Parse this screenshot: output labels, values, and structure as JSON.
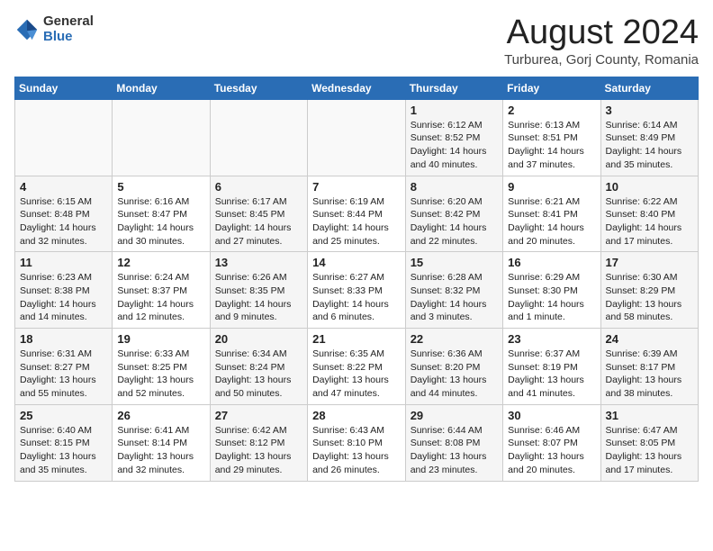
{
  "logo": {
    "general": "General",
    "blue": "Blue"
  },
  "title": "August 2024",
  "location": "Turburea, Gorj County, Romania",
  "headers": [
    "Sunday",
    "Monday",
    "Tuesday",
    "Wednesday",
    "Thursday",
    "Friday",
    "Saturday"
  ],
  "weeks": [
    [
      {
        "day": "",
        "info": ""
      },
      {
        "day": "",
        "info": ""
      },
      {
        "day": "",
        "info": ""
      },
      {
        "day": "",
        "info": ""
      },
      {
        "day": "1",
        "info": "Sunrise: 6:12 AM\nSunset: 8:52 PM\nDaylight: 14 hours\nand 40 minutes."
      },
      {
        "day": "2",
        "info": "Sunrise: 6:13 AM\nSunset: 8:51 PM\nDaylight: 14 hours\nand 37 minutes."
      },
      {
        "day": "3",
        "info": "Sunrise: 6:14 AM\nSunset: 8:49 PM\nDaylight: 14 hours\nand 35 minutes."
      }
    ],
    [
      {
        "day": "4",
        "info": "Sunrise: 6:15 AM\nSunset: 8:48 PM\nDaylight: 14 hours\nand 32 minutes."
      },
      {
        "day": "5",
        "info": "Sunrise: 6:16 AM\nSunset: 8:47 PM\nDaylight: 14 hours\nand 30 minutes."
      },
      {
        "day": "6",
        "info": "Sunrise: 6:17 AM\nSunset: 8:45 PM\nDaylight: 14 hours\nand 27 minutes."
      },
      {
        "day": "7",
        "info": "Sunrise: 6:19 AM\nSunset: 8:44 PM\nDaylight: 14 hours\nand 25 minutes."
      },
      {
        "day": "8",
        "info": "Sunrise: 6:20 AM\nSunset: 8:42 PM\nDaylight: 14 hours\nand 22 minutes."
      },
      {
        "day": "9",
        "info": "Sunrise: 6:21 AM\nSunset: 8:41 PM\nDaylight: 14 hours\nand 20 minutes."
      },
      {
        "day": "10",
        "info": "Sunrise: 6:22 AM\nSunset: 8:40 PM\nDaylight: 14 hours\nand 17 minutes."
      }
    ],
    [
      {
        "day": "11",
        "info": "Sunrise: 6:23 AM\nSunset: 8:38 PM\nDaylight: 14 hours\nand 14 minutes."
      },
      {
        "day": "12",
        "info": "Sunrise: 6:24 AM\nSunset: 8:37 PM\nDaylight: 14 hours\nand 12 minutes."
      },
      {
        "day": "13",
        "info": "Sunrise: 6:26 AM\nSunset: 8:35 PM\nDaylight: 14 hours\nand 9 minutes."
      },
      {
        "day": "14",
        "info": "Sunrise: 6:27 AM\nSunset: 8:33 PM\nDaylight: 14 hours\nand 6 minutes."
      },
      {
        "day": "15",
        "info": "Sunrise: 6:28 AM\nSunset: 8:32 PM\nDaylight: 14 hours\nand 3 minutes."
      },
      {
        "day": "16",
        "info": "Sunrise: 6:29 AM\nSunset: 8:30 PM\nDaylight: 14 hours\nand 1 minute."
      },
      {
        "day": "17",
        "info": "Sunrise: 6:30 AM\nSunset: 8:29 PM\nDaylight: 13 hours\nand 58 minutes."
      }
    ],
    [
      {
        "day": "18",
        "info": "Sunrise: 6:31 AM\nSunset: 8:27 PM\nDaylight: 13 hours\nand 55 minutes."
      },
      {
        "day": "19",
        "info": "Sunrise: 6:33 AM\nSunset: 8:25 PM\nDaylight: 13 hours\nand 52 minutes."
      },
      {
        "day": "20",
        "info": "Sunrise: 6:34 AM\nSunset: 8:24 PM\nDaylight: 13 hours\nand 50 minutes."
      },
      {
        "day": "21",
        "info": "Sunrise: 6:35 AM\nSunset: 8:22 PM\nDaylight: 13 hours\nand 47 minutes."
      },
      {
        "day": "22",
        "info": "Sunrise: 6:36 AM\nSunset: 8:20 PM\nDaylight: 13 hours\nand 44 minutes."
      },
      {
        "day": "23",
        "info": "Sunrise: 6:37 AM\nSunset: 8:19 PM\nDaylight: 13 hours\nand 41 minutes."
      },
      {
        "day": "24",
        "info": "Sunrise: 6:39 AM\nSunset: 8:17 PM\nDaylight: 13 hours\nand 38 minutes."
      }
    ],
    [
      {
        "day": "25",
        "info": "Sunrise: 6:40 AM\nSunset: 8:15 PM\nDaylight: 13 hours\nand 35 minutes."
      },
      {
        "day": "26",
        "info": "Sunrise: 6:41 AM\nSunset: 8:14 PM\nDaylight: 13 hours\nand 32 minutes."
      },
      {
        "day": "27",
        "info": "Sunrise: 6:42 AM\nSunset: 8:12 PM\nDaylight: 13 hours\nand 29 minutes."
      },
      {
        "day": "28",
        "info": "Sunrise: 6:43 AM\nSunset: 8:10 PM\nDaylight: 13 hours\nand 26 minutes."
      },
      {
        "day": "29",
        "info": "Sunrise: 6:44 AM\nSunset: 8:08 PM\nDaylight: 13 hours\nand 23 minutes."
      },
      {
        "day": "30",
        "info": "Sunrise: 6:46 AM\nSunset: 8:07 PM\nDaylight: 13 hours\nand 20 minutes."
      },
      {
        "day": "31",
        "info": "Sunrise: 6:47 AM\nSunset: 8:05 PM\nDaylight: 13 hours\nand 17 minutes."
      }
    ]
  ]
}
